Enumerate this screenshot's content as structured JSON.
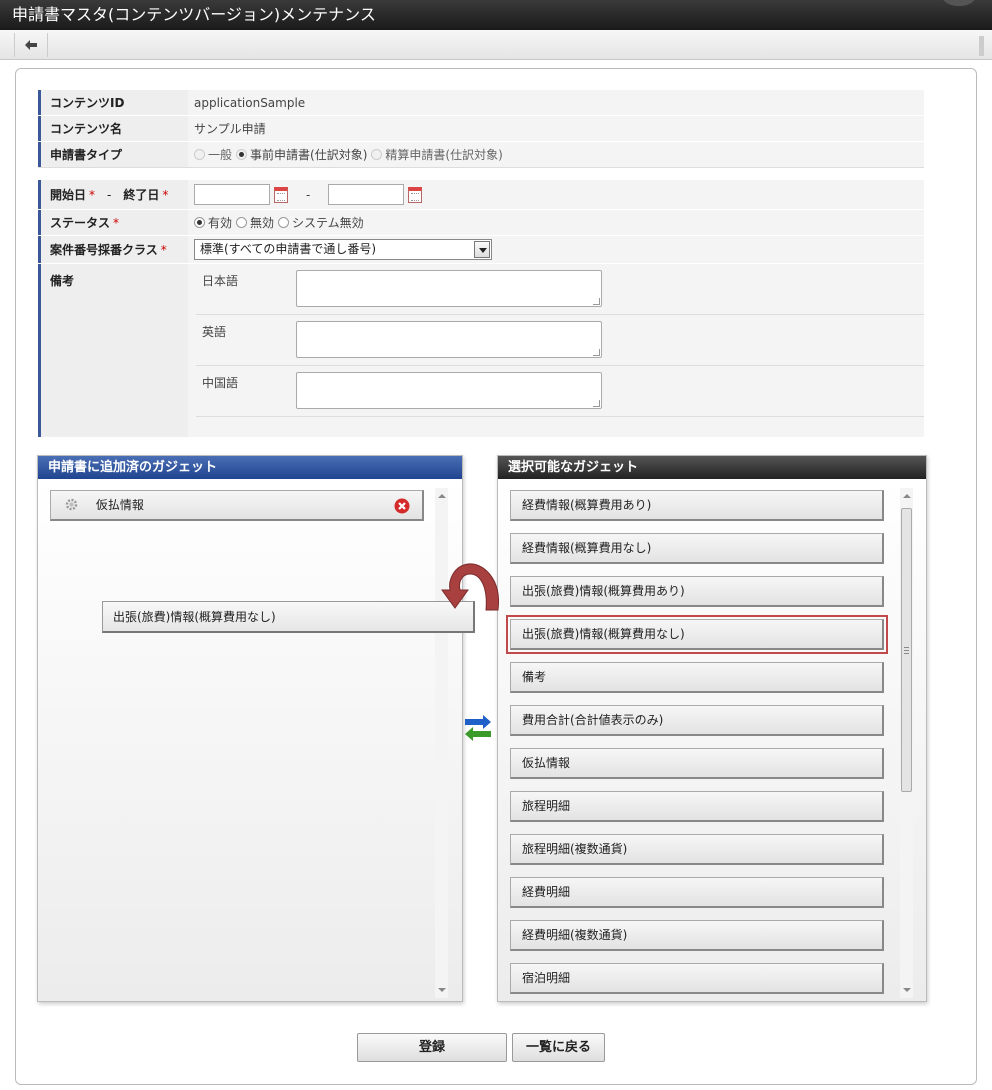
{
  "window": {
    "title": "申請書マスタ(コンテンツバージョン)メンテナンス"
  },
  "form": {
    "content_id": {
      "label": "コンテンツID",
      "value": "applicationSample"
    },
    "content_name": {
      "label": "コンテンツ名",
      "value": "サンプル申請"
    },
    "form_type": {
      "label": "申請書タイプ",
      "options": [
        {
          "label": "一般",
          "selected": false
        },
        {
          "label": "事前申請書(仕訳対象)",
          "selected": true
        },
        {
          "label": "精算申請書(仕訳対象)",
          "selected": false
        }
      ]
    },
    "dates": {
      "start_label": "開始日",
      "dash": "-",
      "end_label": "終了日",
      "required_mark": "*",
      "range_sep": "-",
      "start_value": "",
      "end_value": ""
    },
    "status": {
      "label": "ステータス",
      "required_mark": "*",
      "options": [
        {
          "label": "有効",
          "selected": true
        },
        {
          "label": "無効",
          "selected": false
        },
        {
          "label": "システム無効",
          "selected": false
        }
      ]
    },
    "numbering": {
      "label": "案件番号採番クラス",
      "required_mark": "*",
      "value": "標準(すべての申請書で通し番号)"
    },
    "notes": {
      "label": "備考",
      "languages": [
        {
          "label": "日本語",
          "value": ""
        },
        {
          "label": "英語",
          "value": ""
        },
        {
          "label": "中国語",
          "value": ""
        }
      ]
    }
  },
  "added_gadgets": {
    "title": "申請書に追加済のガジェット",
    "items": [
      {
        "label": "仮払情報"
      }
    ]
  },
  "drag_ghost": {
    "label": "出張(旅費)情報(概算費用なし)"
  },
  "available_gadgets": {
    "title": "選択可能なガジェット",
    "items": [
      {
        "label": "経費情報(概算費用あり)"
      },
      {
        "label": "経費情報(概算費用なし)"
      },
      {
        "label": "出張(旅費)情報(概算費用あり)"
      },
      {
        "label": "出張(旅費)情報(概算費用なし)",
        "highlighted": true
      },
      {
        "label": "備考"
      },
      {
        "label": "費用合計(合計値表示のみ)"
      },
      {
        "label": "仮払情報"
      },
      {
        "label": "旅程明細"
      },
      {
        "label": "旅程明細(複数通貨)"
      },
      {
        "label": "経費明細"
      },
      {
        "label": "経費明細(複数通貨)"
      },
      {
        "label": "宿泊明細"
      }
    ]
  },
  "buttons": {
    "register": "登録",
    "back_to_list": "一覧に戻る"
  },
  "colors": {
    "header_blue": "#1f448f",
    "header_dark": "#222222",
    "highlight": "#c04a4a",
    "required": "#cc0000",
    "arrow_red": "#b54a4a"
  }
}
